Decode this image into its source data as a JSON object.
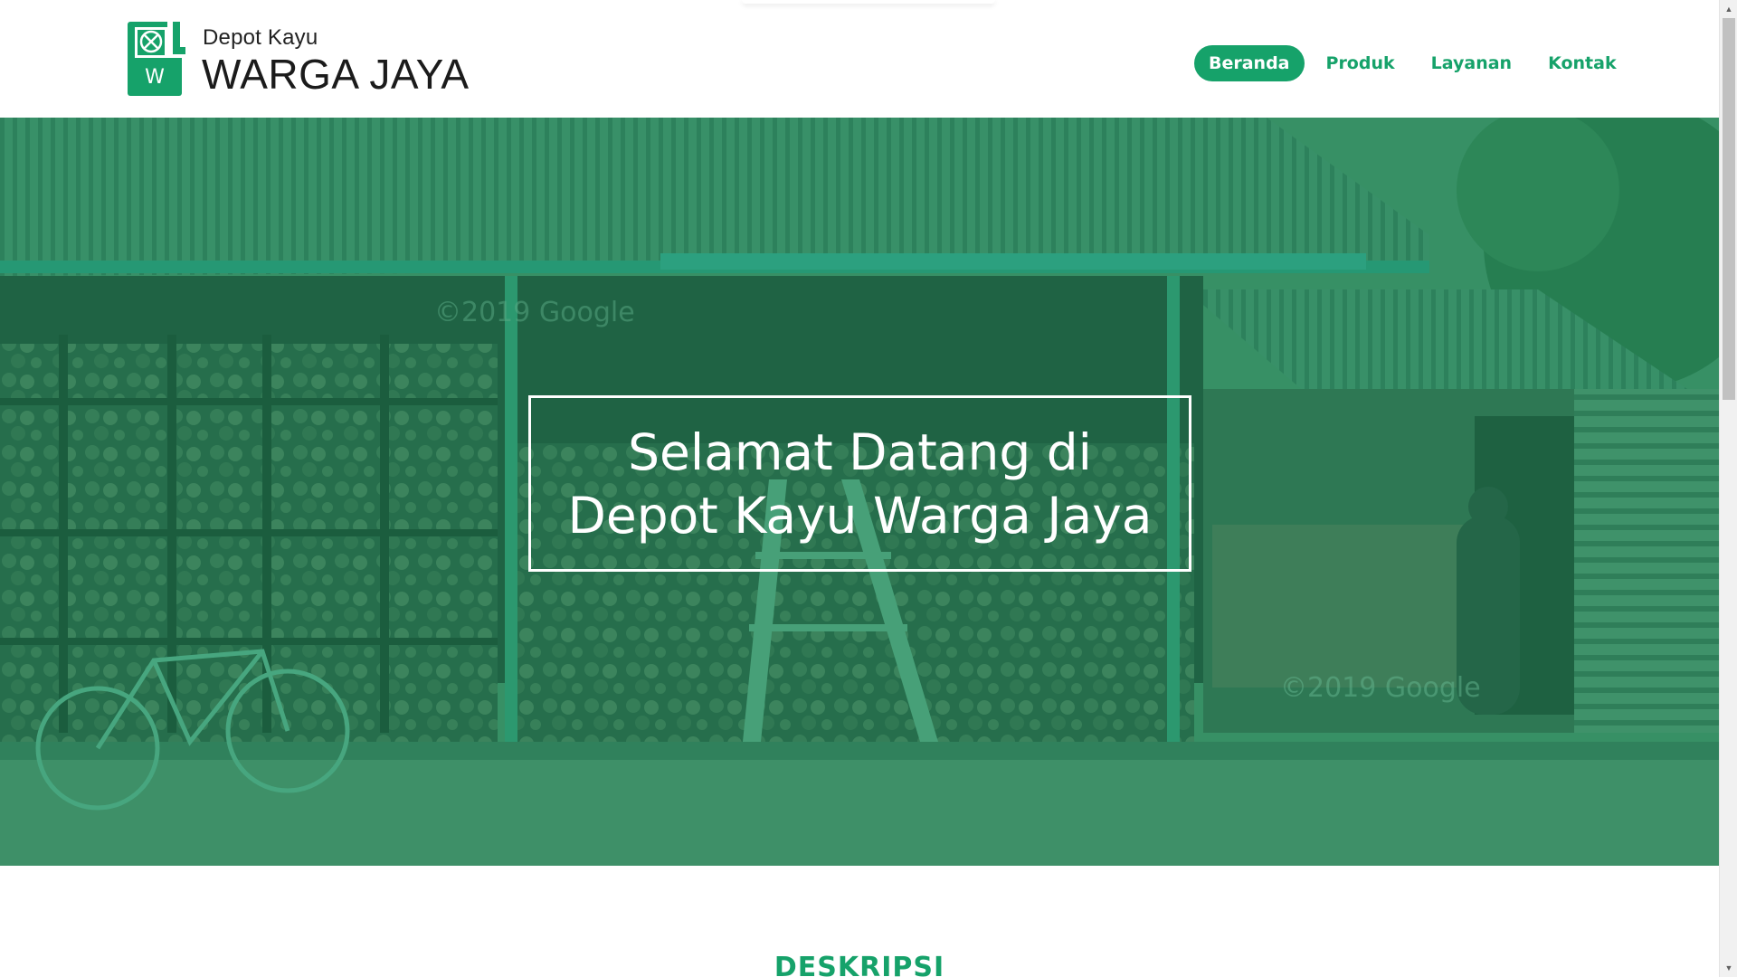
{
  "brand": {
    "small": "Depot Kayu",
    "big": "WARGA JAYA",
    "logo_letter": "W",
    "color": "#16a26a"
  },
  "nav": {
    "items": [
      {
        "label": "Beranda",
        "active": true
      },
      {
        "label": "Produk",
        "active": false
      },
      {
        "label": "Layanan",
        "active": false
      },
      {
        "label": "Kontak",
        "active": false
      }
    ]
  },
  "hero": {
    "line1": "Selamat Datang di",
    "line2": "Depot Kayu Warga Jaya",
    "watermark1": "©2019 Google",
    "watermark2": "©2019 Google",
    "overlay_color": "#1c965f"
  },
  "section": {
    "title": "DESKRIPSI"
  },
  "icons": {
    "logo": "saw-blade-logo-icon",
    "scroll_up": "chevron-up-icon",
    "scroll_down": "chevron-down-icon"
  }
}
